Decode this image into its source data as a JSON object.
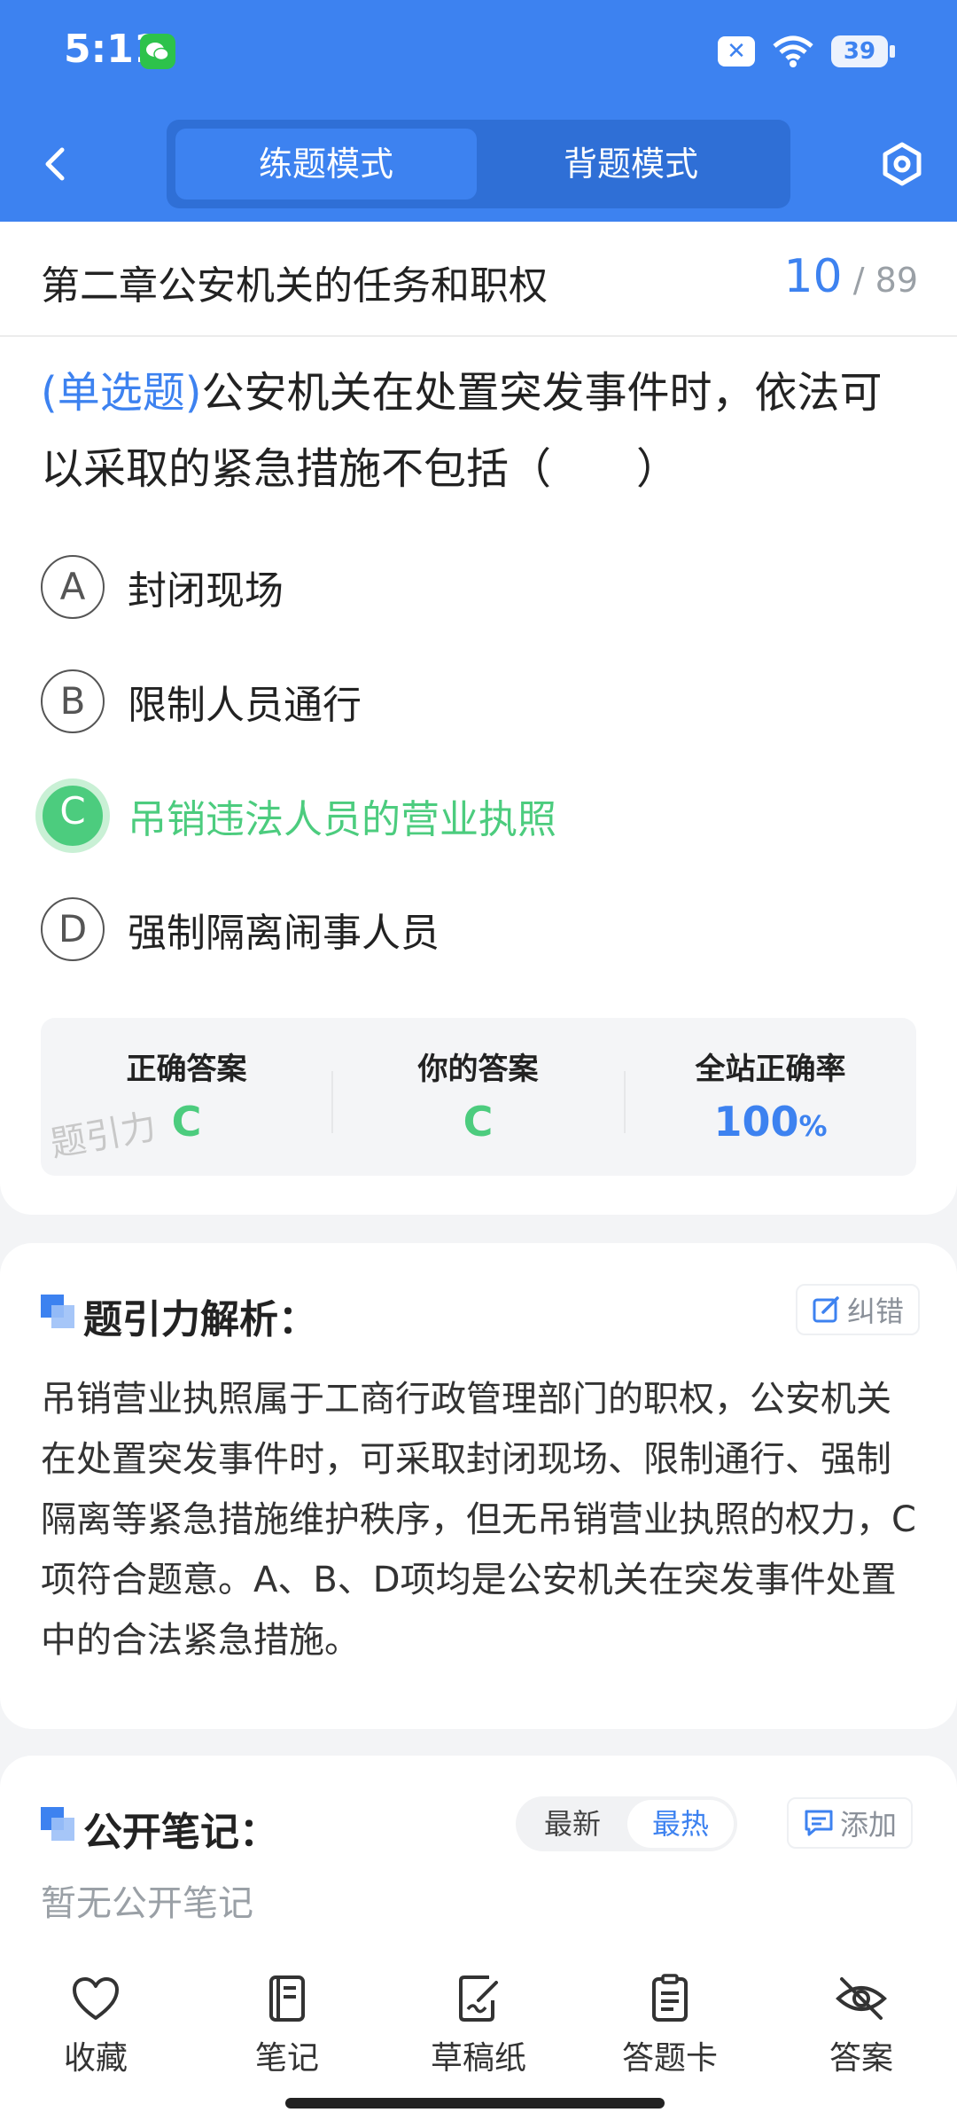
{
  "status_bar": {
    "time": "5:11",
    "battery": "39"
  },
  "header": {
    "modes": [
      {
        "label": "练题模式",
        "active": true
      },
      {
        "label": "背题模式",
        "active": false
      }
    ]
  },
  "chapter": {
    "title": "第二章公安机关的任务和职权",
    "current": "10",
    "separator": "/",
    "total": "89"
  },
  "question": {
    "type_tag": "(单选题)",
    "text": "公安机关在处置突发事件时，依法可以采取的紧急措施不包括（　　）",
    "options": [
      {
        "letter": "A",
        "text": "封闭现场"
      },
      {
        "letter": "B",
        "text": "限制人员通行"
      },
      {
        "letter": "C",
        "text": "吊销违法人员的营业执照",
        "selected": true,
        "correct": true
      },
      {
        "letter": "D",
        "text": "强制隔离闹事人员"
      }
    ]
  },
  "stats": {
    "correct_label": "正确答案",
    "correct_value": "C",
    "your_label": "你的答案",
    "your_value": "C",
    "rate_label": "全站正确率",
    "rate_value": "100",
    "rate_unit": "%",
    "watermark": "题引力"
  },
  "analysis": {
    "title": "题引力解析：",
    "correct_btn": "纠错",
    "text": "吊销营业执照属于工商行政管理部门的职权，公安机关在处置突发事件时，可采取封闭现场、限制通行、强制隔离等紧急措施维护秩序，但无吊销营业执照的权力，C项符合题意。A、B、D项均是公安机关在突发事件处置中的合法紧急措施。"
  },
  "notes": {
    "title": "公开笔记：",
    "sort_latest": "最新",
    "sort_hot": "最热",
    "sort_active": "最热",
    "add_btn": "添加",
    "empty": "暂无公开笔记"
  },
  "bottom_tabs": [
    {
      "label": "收藏",
      "icon": "heart-icon"
    },
    {
      "label": "笔记",
      "icon": "notebook-icon"
    },
    {
      "label": "草稿纸",
      "icon": "draft-icon"
    },
    {
      "label": "答题卡",
      "icon": "clipboard-icon"
    },
    {
      "label": "答案",
      "icon": "eye-off-icon"
    }
  ],
  "colors": {
    "primary": "#3d82f0",
    "correct": "#4ccc7e",
    "header_bg": "#3d82f0"
  }
}
